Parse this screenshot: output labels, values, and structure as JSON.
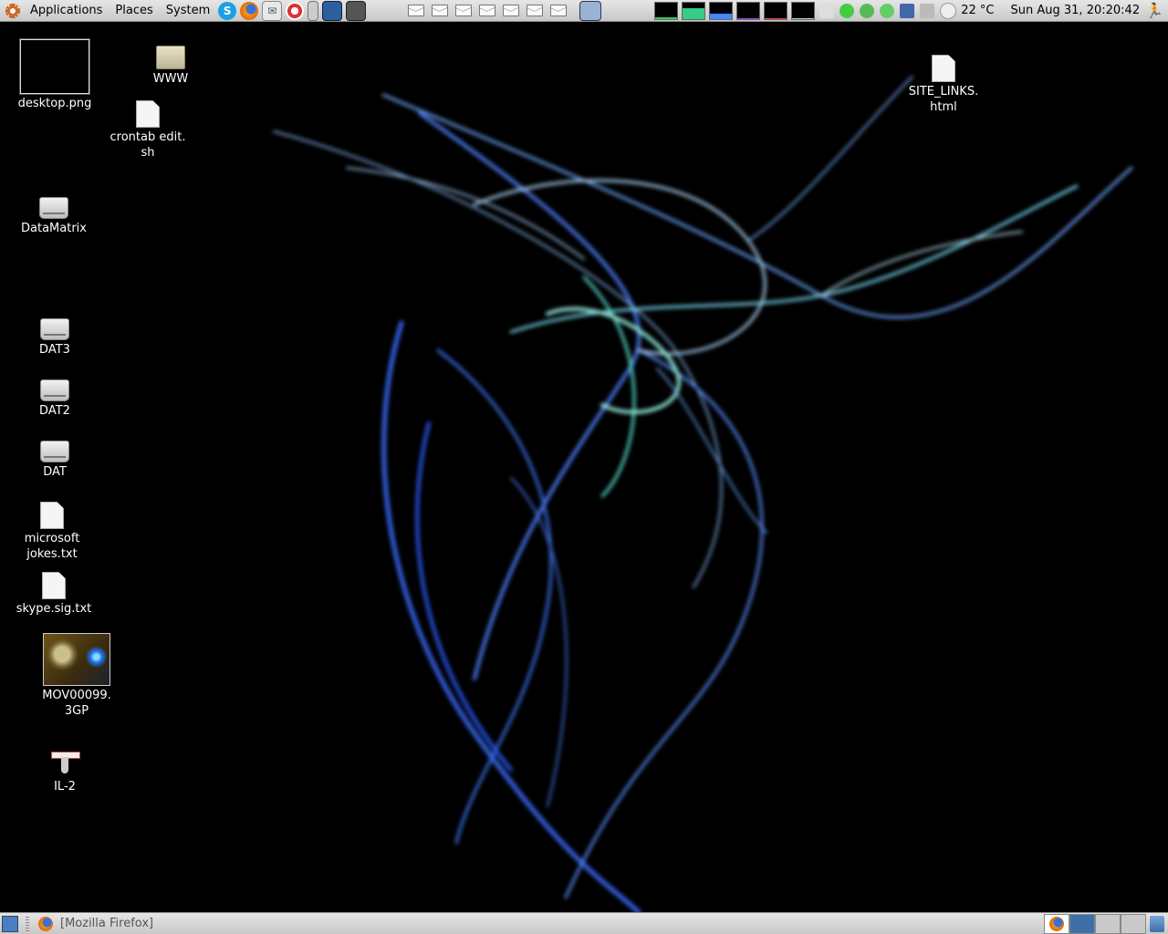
{
  "top_panel": {
    "menus": [
      "Applications",
      "Places",
      "System"
    ],
    "weather": "22 °C",
    "clock": "Sun Aug 31, 20:20:42"
  },
  "desktop_icons": {
    "desktop_png": "desktop.png",
    "www": "WWW",
    "crontab": "crontab edit.\nsh",
    "site_links": "SITE_LINKS.\nhtml",
    "datamatrix": "DataMatrix",
    "dat3": "DAT3",
    "dat2": "DAT2",
    "dat": "DAT",
    "ms_jokes": "microsoft\njokes.txt",
    "skype_sig": "skype.sig.txt",
    "mov": "MOV00099.\n3GP",
    "il2": "IL-2"
  },
  "bottom_panel": {
    "task_firefox": "[Mozilla Firefox]"
  },
  "colors": {
    "panel": "#d6d6d6",
    "accent_blue": "#3e6ea8"
  }
}
